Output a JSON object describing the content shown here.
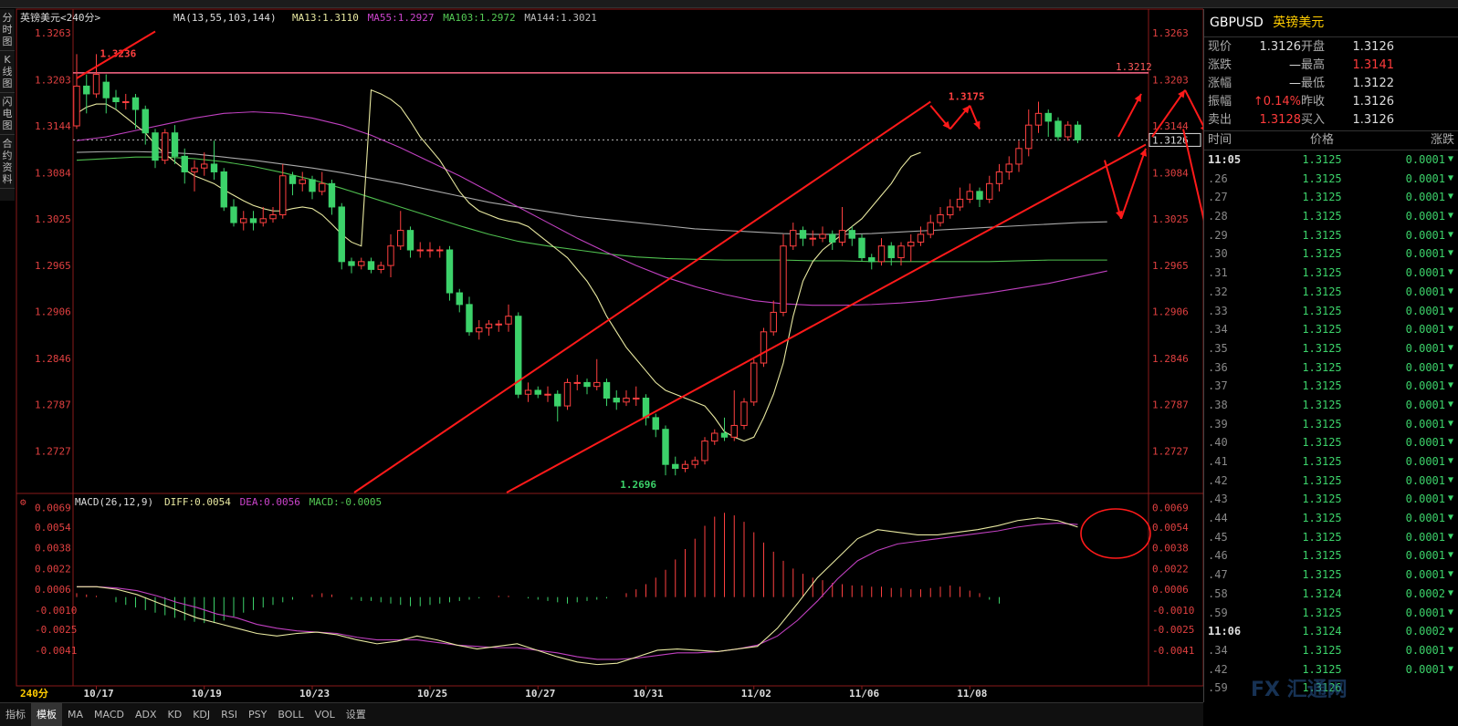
{
  "chart_data": {
    "type": "candlestick",
    "title": "英镑美元<240分>",
    "ma_legend": {
      "label": "MA(13,55,103,144)",
      "items": [
        {
          "name": "MA13",
          "value": "1.3110",
          "color": "#e8e8a0"
        },
        {
          "name": "MA55",
          "value": "1.2927",
          "color": "#cc44cc"
        },
        {
          "name": "MA103",
          "value": "1.2972",
          "color": "#55cc55"
        },
        {
          "name": "MA144",
          "value": "1.3021",
          "color": "#bbbbbb"
        }
      ]
    },
    "y_ticks": [
      "1.3263",
      "1.3203",
      "1.3144",
      "1.3084",
      "1.3025",
      "1.2965",
      "1.2906",
      "1.2846",
      "1.2787",
      "1.2727"
    ],
    "ylim": [
      1.2674,
      1.3289
    ],
    "x_labels": [
      {
        "label": "10/17",
        "bar": 2
      },
      {
        "label": "10/19",
        "bar": 13
      },
      {
        "label": "10/23",
        "bar": 24
      },
      {
        "label": "10/25",
        "bar": 36
      },
      {
        "label": "10/27",
        "bar": 47
      },
      {
        "label": "10/31",
        "bar": 58
      },
      {
        "label": "11/02",
        "bar": 69
      },
      {
        "label": "11/06",
        "bar": 80
      },
      {
        "label": "11/08",
        "bar": 91
      }
    ],
    "annotations": [
      {
        "text": "1.3236",
        "bar": 2,
        "value": 1.3236
      },
      {
        "text": "1.2696",
        "bar": 55,
        "value": 1.2696
      },
      {
        "text": "1.3175",
        "bar": 89,
        "value": 1.3175
      },
      {
        "text": "1.3212",
        "value": 1.3212
      },
      {
        "text": "1.3126",
        "value": 1.3126
      }
    ],
    "candles": [
      [
        1.3144,
        1.3195,
        1.3236,
        1.314
      ],
      [
        1.3195,
        1.3185,
        1.321,
        1.316
      ],
      [
        1.3185,
        1.321,
        1.3236,
        1.318
      ],
      [
        1.32,
        1.318,
        1.321,
        1.316
      ],
      [
        1.318,
        1.3175,
        1.319,
        1.3165
      ],
      [
        1.3175,
        1.3175,
        1.3185,
        1.3165
      ],
      [
        1.318,
        1.3165,
        1.3185,
        1.314
      ],
      [
        1.3165,
        1.3135,
        1.317,
        1.312
      ],
      [
        1.3135,
        1.31,
        1.314,
        1.309
      ],
      [
        1.31,
        1.3135,
        1.314,
        1.3095
      ],
      [
        1.3135,
        1.3105,
        1.3145,
        1.3095
      ],
      [
        1.3105,
        1.3085,
        1.3115,
        1.307
      ],
      [
        1.3085,
        1.309,
        1.31,
        1.306
      ],
      [
        1.309,
        1.3095,
        1.311,
        1.308
      ],
      [
        1.3095,
        1.3085,
        1.3125,
        1.3075
      ],
      [
        1.3085,
        1.304,
        1.309,
        1.3035
      ],
      [
        1.304,
        1.302,
        1.305,
        1.3015
      ],
      [
        1.302,
        1.3025,
        1.3035,
        1.301
      ],
      [
        1.3025,
        1.302,
        1.3035,
        1.301
      ],
      [
        1.302,
        1.3025,
        1.304,
        1.3015
      ],
      [
        1.3025,
        1.303,
        1.304,
        1.302
      ],
      [
        1.303,
        1.308,
        1.3095,
        1.3025
      ],
      [
        1.308,
        1.307,
        1.3085,
        1.3055
      ],
      [
        1.307,
        1.3075,
        1.3085,
        1.306
      ],
      [
        1.3075,
        1.306,
        1.308,
        1.305
      ],
      [
        1.306,
        1.307,
        1.3085,
        1.3055
      ],
      [
        1.307,
        1.304,
        1.3075,
        1.303
      ],
      [
        1.304,
        1.297,
        1.3045,
        1.296
      ],
      [
        1.297,
        1.2965,
        1.2975,
        1.2955
      ],
      [
        1.2965,
        1.297,
        1.2975,
        1.296
      ],
      [
        1.297,
        1.296,
        1.2975,
        1.2955
      ],
      [
        1.296,
        1.2965,
        1.297,
        1.2955
      ],
      [
        1.2965,
        1.299,
        1.3005,
        1.295
      ],
      [
        1.299,
        1.301,
        1.3035,
        1.2985
      ],
      [
        1.301,
        1.2985,
        1.3015,
        1.2975
      ],
      [
        1.2985,
        1.2985,
        1.2995,
        1.2975
      ],
      [
        1.2985,
        1.2985,
        1.2995,
        1.2975
      ],
      [
        1.2985,
        1.2985,
        1.299,
        1.2975
      ],
      [
        1.2985,
        1.293,
        1.299,
        1.292
      ],
      [
        1.293,
        1.2915,
        1.2935,
        1.2905
      ],
      [
        1.2915,
        1.288,
        1.2925,
        1.2875
      ],
      [
        1.288,
        1.2885,
        1.2895,
        1.287
      ],
      [
        1.2885,
        1.289,
        1.2895,
        1.2875
      ],
      [
        1.289,
        1.289,
        1.2895,
        1.288
      ],
      [
        1.289,
        1.29,
        1.2915,
        1.288
      ],
      [
        1.29,
        1.28,
        1.2905,
        1.2795
      ],
      [
        1.28,
        1.2805,
        1.2815,
        1.279
      ],
      [
        1.2805,
        1.28,
        1.281,
        1.2795
      ],
      [
        1.28,
        1.28,
        1.281,
        1.279
      ],
      [
        1.28,
        1.2785,
        1.2805,
        1.2765
      ],
      [
        1.2785,
        1.2815,
        1.282,
        1.278
      ],
      [
        1.2815,
        1.2815,
        1.2825,
        1.2805
      ],
      [
        1.2815,
        1.281,
        1.282,
        1.28
      ],
      [
        1.281,
        1.2815,
        1.2845,
        1.2805
      ],
      [
        1.2815,
        1.2795,
        1.282,
        1.2785
      ],
      [
        1.2795,
        1.279,
        1.2805,
        1.278
      ],
      [
        1.279,
        1.2795,
        1.2805,
        1.2785
      ],
      [
        1.2795,
        1.2795,
        1.281,
        1.2785
      ],
      [
        1.2795,
        1.277,
        1.28,
        1.276
      ],
      [
        1.277,
        1.2755,
        1.2775,
        1.2745
      ],
      [
        1.2755,
        1.271,
        1.276,
        1.2696
      ],
      [
        1.271,
        1.2705,
        1.272,
        1.2696
      ],
      [
        1.2705,
        1.271,
        1.2715,
        1.27
      ],
      [
        1.271,
        1.2715,
        1.272,
        1.2705
      ],
      [
        1.2715,
        1.274,
        1.2745,
        1.271
      ],
      [
        1.274,
        1.275,
        1.2755,
        1.2735
      ],
      [
        1.275,
        1.2745,
        1.277,
        1.274
      ],
      [
        1.2745,
        1.276,
        1.2805,
        1.274
      ],
      [
        1.276,
        1.279,
        1.2795,
        1.2755
      ],
      [
        1.279,
        1.284,
        1.2845,
        1.2785
      ],
      [
        1.284,
        1.288,
        1.2885,
        1.2835
      ],
      [
        1.288,
        1.2905,
        1.292,
        1.2875
      ],
      [
        1.2905,
        1.299,
        1.3005,
        1.29
      ],
      [
        1.299,
        1.301,
        1.302,
        1.2985
      ],
      [
        1.301,
        1.3,
        1.3015,
        1.299
      ],
      [
        1.3,
        1.3,
        1.301,
        1.299
      ],
      [
        1.3,
        1.3005,
        1.3015,
        1.2995
      ],
      [
        1.3005,
        1.2995,
        1.301,
        1.2985
      ],
      [
        1.2995,
        1.301,
        1.304,
        1.299
      ],
      [
        1.301,
        1.3,
        1.3015,
        1.299
      ],
      [
        1.3,
        1.2975,
        1.3005,
        1.297
      ],
      [
        1.2975,
        1.297,
        1.298,
        1.296
      ],
      [
        1.297,
        1.299,
        1.3,
        1.2965
      ],
      [
        1.299,
        1.2975,
        1.2995,
        1.2965
      ],
      [
        1.2975,
        1.299,
        1.2995,
        1.2965
      ],
      [
        1.299,
        1.2995,
        1.3005,
        1.297
      ],
      [
        1.2995,
        1.3005,
        1.3015,
        1.299
      ],
      [
        1.3005,
        1.302,
        1.303,
        1.3
      ],
      [
        1.302,
        1.303,
        1.304,
        1.3015
      ],
      [
        1.303,
        1.304,
        1.305,
        1.3025
      ],
      [
        1.304,
        1.305,
        1.3065,
        1.3035
      ],
      [
        1.305,
        1.306,
        1.307,
        1.3045
      ],
      [
        1.306,
        1.305,
        1.3065,
        1.304
      ],
      [
        1.305,
        1.307,
        1.308,
        1.3045
      ],
      [
        1.307,
        1.3085,
        1.3095,
        1.306
      ],
      [
        1.3085,
        1.3095,
        1.3105,
        1.3075
      ],
      [
        1.3095,
        1.3115,
        1.3125,
        1.3085
      ],
      [
        1.3115,
        1.3145,
        1.3165,
        1.3105
      ],
      [
        1.3145,
        1.316,
        1.3175,
        1.3135
      ],
      [
        1.316,
        1.315,
        1.3165,
        1.313
      ],
      [
        1.315,
        1.313,
        1.3155,
        1.3125
      ],
      [
        1.313,
        1.3145,
        1.315,
        1.3125
      ],
      [
        1.3145,
        1.3126,
        1.315,
        1.3122
      ]
    ],
    "ma13": [
      1.319,
      1.3185,
      1.3178,
      1.3168,
      1.315,
      1.313,
      1.3115,
      1.31,
      1.308,
      1.306,
      1.3045,
      1.3035,
      1.303,
      1.3025,
      1.3022,
      1.302,
      1.3015,
      1.3005,
      1.2995,
      1.2985,
      1.2975,
      1.296,
      1.2945,
      1.2925,
      1.29,
      1.288,
      1.286,
      1.2845,
      1.283,
      1.2815,
      1.2805,
      1.28,
      1.2795,
      1.279,
      1.2785,
      1.277,
      1.2752,
      1.2745,
      1.274,
      1.2745,
      1.277,
      1.28,
      1.284,
      1.29,
      1.2945,
      1.297,
      1.2985,
      1.2995,
      1.3005,
      1.3015,
      1.3025,
      1.304,
      1.3055,
      1.307,
      1.309,
      1.3105,
      1.311
    ],
    "ma13_start": 30,
    "ma55": [
      1.3125,
      1.313,
      1.3138,
      1.3146,
      1.3154,
      1.316,
      1.3162,
      1.316,
      1.3154,
      1.3145,
      1.3132,
      1.3116,
      1.3098,
      1.308,
      1.306,
      1.304,
      1.302,
      1.3,
      1.2982,
      1.2965,
      1.295,
      1.2938,
      1.2928,
      1.292,
      1.2916,
      1.2914,
      1.2914,
      1.2915,
      1.2917,
      1.292,
      1.2925,
      1.293,
      1.2936,
      1.2942,
      1.295,
      1.2958
    ],
    "ma55_step": 3,
    "ma103": [
      1.31,
      1.3102,
      1.3104,
      1.3104,
      1.3102,
      1.3098,
      1.3092,
      1.3084,
      1.3075,
      1.3064,
      1.3052,
      1.304,
      1.3028,
      1.3016,
      1.3005,
      1.2996,
      1.299,
      1.2985,
      1.298,
      1.2976,
      1.2974,
      1.2973,
      1.2972,
      1.2972,
      1.2972,
      1.2971,
      1.2971,
      1.297,
      1.297,
      1.297,
      1.297,
      1.297,
      1.2971,
      1.2972,
      1.2972,
      1.2972
    ],
    "ma144": [
      1.311,
      1.3111,
      1.3111,
      1.311,
      1.3108,
      1.3104,
      1.31,
      1.3095,
      1.309,
      1.3084,
      1.3077,
      1.307,
      1.3062,
      1.3054,
      1.3046,
      1.304,
      1.3034,
      1.3028,
      1.3024,
      1.302,
      1.3016,
      1.3012,
      1.301,
      1.3008,
      1.3006,
      1.3005,
      1.3005,
      1.3006,
      1.3008,
      1.301,
      1.3012,
      1.3014,
      1.3016,
      1.3018,
      1.302,
      1.3021
    ],
    "macd": {
      "legend": {
        "label": "MACD(26,12,9)",
        "items": [
          {
            "name": "DIFF",
            "value": "0.0054",
            "color": "#e8e8a0"
          },
          {
            "name": "DEA",
            "value": "0.0056",
            "color": "#cc44cc"
          },
          {
            "name": "MACD",
            "value": "-0.0005",
            "color": "#55cc55"
          }
        ]
      },
      "y_ticks": [
        "0.0069",
        "0.0054",
        "0.0038",
        "0.0022",
        "0.0006",
        "-0.0010",
        "-0.0025",
        "-0.0041"
      ],
      "ylim": [
        -0.006,
        0.0075
      ],
      "hist": [
        0.0003,
        0.0002,
        0.0001,
        0,
        -0.0004,
        -0.0006,
        -0.0008,
        -0.001,
        -0.0012,
        -0.0014,
        -0.0016,
        -0.0018,
        -0.0019,
        -0.002,
        -0.002,
        -0.0018,
        -0.0015,
        -0.0012,
        -0.001,
        -0.0008,
        -0.0006,
        -0.0004,
        -0.0002,
        0,
        0.0002,
        0.0003,
        0.0002,
        0,
        -0.0002,
        -0.0003,
        -0.0003,
        -0.0004,
        -0.0005,
        -0.0006,
        -0.0007,
        -0.0007,
        -0.0006,
        -0.0005,
        -0.0004,
        -0.0003,
        -0.0002,
        -0.0001,
        0,
        0.0001,
        0.0001,
        0,
        -0.0001,
        -0.0002,
        -0.0003,
        -0.0004,
        -0.0005,
        -0.0004,
        -0.0003,
        -0.0002,
        -0.0001,
        0,
        0.0003,
        0.0006,
        0.001,
        0.0015,
        0.0021,
        0.0029,
        0.0037,
        0.0045,
        0.0055,
        0.0062,
        0.0065,
        0.0063,
        0.0058,
        0.005,
        0.0042,
        0.0035,
        0.0028,
        0.0022,
        0.0018,
        0.0015,
        0.0013,
        0.0011,
        0.001,
        0.0009,
        0.0009,
        0.0008,
        0.0008,
        0.0007,
        0.0007,
        0.0006,
        0.0006,
        0.0007,
        0.0008,
        0.0009,
        0.0008,
        0.0005,
        0.0003,
        -0.0002,
        -0.0005
      ],
      "diff": [
        0.0008,
        0.0008,
        0.0006,
        0.0002,
        -0.0004,
        -0.001,
        -0.0016,
        -0.002,
        -0.0024,
        -0.0028,
        -0.003,
        -0.0028,
        -0.0027,
        -0.0029,
        -0.0033,
        -0.0036,
        -0.0034,
        -0.003,
        -0.0033,
        -0.0037,
        -0.004,
        -0.0038,
        -0.0036,
        -0.0041,
        -0.0046,
        -0.005,
        -0.0052,
        -0.0051,
        -0.0046,
        -0.0041,
        -0.004,
        -0.0041,
        -0.0042,
        -0.004,
        -0.0038,
        -0.0024,
        -0.0005,
        0.0015,
        0.003,
        0.0045,
        0.0052,
        0.005,
        0.0048,
        0.0048,
        0.005,
        0.0052,
        0.0055,
        0.0059,
        0.0061,
        0.0059,
        0.0054
      ],
      "dea": [
        0.0008,
        0.0008,
        0.0007,
        0.0005,
        0.0001,
        -0.0004,
        -0.0008,
        -0.0013,
        -0.0016,
        -0.0021,
        -0.0024,
        -0.0026,
        -0.0027,
        -0.0028,
        -0.0031,
        -0.0033,
        -0.0033,
        -0.0033,
        -0.0035,
        -0.0037,
        -0.0038,
        -0.0039,
        -0.0039,
        -0.0041,
        -0.0043,
        -0.0046,
        -0.0048,
        -0.0048,
        -0.0047,
        -0.0045,
        -0.0043,
        -0.0043,
        -0.0042,
        -0.004,
        -0.0037,
        -0.003,
        -0.0018,
        -0.0003,
        0.0014,
        0.0028,
        0.0036,
        0.0041,
        0.0043,
        0.0045,
        0.0047,
        0.0049,
        0.0051,
        0.0054,
        0.0056,
        0.0057,
        0.0056
      ]
    },
    "period_label": "240分"
  },
  "side_tabs": [
    "分时图",
    "K线图",
    "闪电图",
    "合约资料"
  ],
  "bottom_tabs": [
    "指标",
    "模板",
    "MA",
    "MACD",
    "ADX",
    "KD",
    "KDJ",
    "RSI",
    "PSY",
    "BOLL",
    "VOL",
    "设置"
  ],
  "quote": {
    "symbol": "GBPUSD",
    "name": "英镑美元",
    "rows": [
      [
        "现价",
        "1.3126",
        "开盘",
        "1.3126"
      ],
      [
        "涨跌",
        "—",
        "最高",
        "1.3141"
      ],
      [
        "涨幅",
        "—",
        "最低",
        "1.3122"
      ],
      [
        "振幅",
        "↑0.14%",
        "昨收",
        "1.3126"
      ],
      [
        "卖出",
        "1.3128",
        "买入",
        "1.3126"
      ]
    ],
    "head": [
      "时间",
      "价格",
      "涨跌"
    ],
    "ticks": [
      [
        "11:05",
        "1.3125",
        "0.0001"
      ],
      [
        ".26",
        "1.3125",
        "0.0001"
      ],
      [
        ".27",
        "1.3125",
        "0.0001"
      ],
      [
        ".28",
        "1.3125",
        "0.0001"
      ],
      [
        ".29",
        "1.3125",
        "0.0001"
      ],
      [
        ".30",
        "1.3125",
        "0.0001"
      ],
      [
        ".31",
        "1.3125",
        "0.0001"
      ],
      [
        ".32",
        "1.3125",
        "0.0001"
      ],
      [
        ".33",
        "1.3125",
        "0.0001"
      ],
      [
        ".34",
        "1.3125",
        "0.0001"
      ],
      [
        ".35",
        "1.3125",
        "0.0001"
      ],
      [
        ".36",
        "1.3125",
        "0.0001"
      ],
      [
        ".37",
        "1.3125",
        "0.0001"
      ],
      [
        ".38",
        "1.3125",
        "0.0001"
      ],
      [
        ".39",
        "1.3125",
        "0.0001"
      ],
      [
        ".40",
        "1.3125",
        "0.0001"
      ],
      [
        ".41",
        "1.3125",
        "0.0001"
      ],
      [
        ".42",
        "1.3125",
        "0.0001"
      ],
      [
        ".43",
        "1.3125",
        "0.0001"
      ],
      [
        ".44",
        "1.3125",
        "0.0001"
      ],
      [
        ".45",
        "1.3125",
        "0.0001"
      ],
      [
        ".46",
        "1.3125",
        "0.0001"
      ],
      [
        ".47",
        "1.3125",
        "0.0001"
      ],
      [
        ".58",
        "1.3124",
        "0.0002"
      ],
      [
        ".59",
        "1.3125",
        "0.0001"
      ],
      [
        "11:06",
        "1.3124",
        "0.0002"
      ],
      [
        ".34",
        "1.3125",
        "0.0001"
      ],
      [
        ".42",
        "1.3125",
        "0.0001"
      ],
      [
        ".59",
        "1.3126",
        ""
      ]
    ]
  },
  "watermark": "FX 汇通网"
}
